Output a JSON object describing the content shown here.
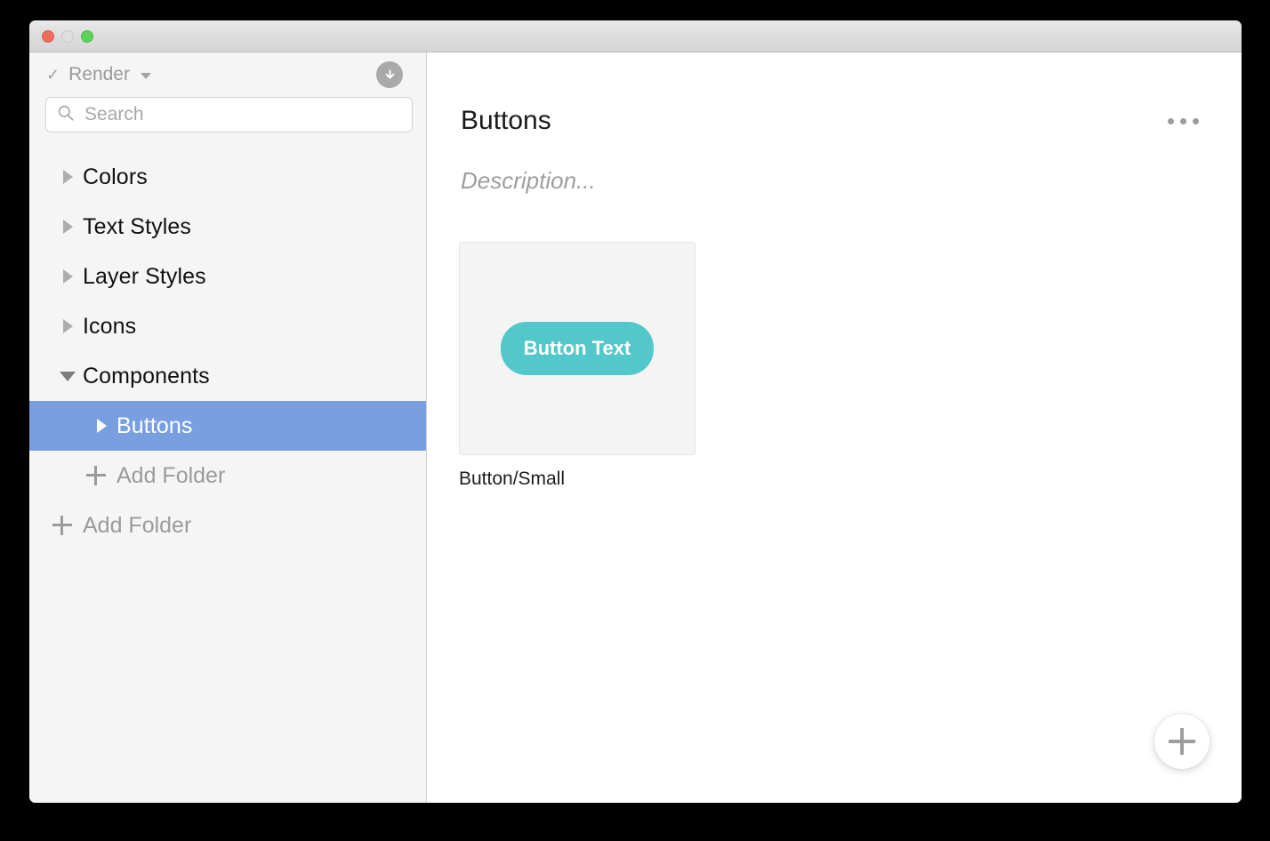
{
  "window": {
    "traffic_lights": [
      "close",
      "minimize",
      "maximize"
    ]
  },
  "sidebar": {
    "document_switcher": {
      "check_glyph": "✓",
      "label": "Render",
      "caret_icon": "chevron-down-icon"
    },
    "sync_icon": "download-arrow-icon",
    "search": {
      "placeholder": "Search",
      "value": "",
      "icon": "search-icon"
    },
    "tree": [
      {
        "label": "Colors",
        "level": 0,
        "expanded": false,
        "selected": false
      },
      {
        "label": "Text Styles",
        "level": 0,
        "expanded": false,
        "selected": false
      },
      {
        "label": "Layer Styles",
        "level": 0,
        "expanded": false,
        "selected": false
      },
      {
        "label": "Icons",
        "level": 0,
        "expanded": false,
        "selected": false
      },
      {
        "label": "Components",
        "level": 0,
        "expanded": true,
        "selected": false
      },
      {
        "label": "Buttons",
        "level": 1,
        "expanded": false,
        "selected": true
      }
    ],
    "add_folder_nested": "Add Folder",
    "add_folder_root": "Add Folder"
  },
  "content": {
    "title": "Buttons",
    "description_placeholder": "Description...",
    "overflow_menu_icon": "ellipsis-icon",
    "components": [
      {
        "name": "Button/Small",
        "preview_label": "Button Text",
        "preview_color": "#52c8ca"
      }
    ],
    "add_component_icon": "plus-icon"
  },
  "colors": {
    "accent_teal": "#52c8ca",
    "selection_blue": "#7a9fe0",
    "sidebar_bg": "#f5f5f5",
    "content_bg": "#ffffff",
    "titlebar_bg": "#dcdcdc",
    "muted_text": "#9b9b9b"
  }
}
